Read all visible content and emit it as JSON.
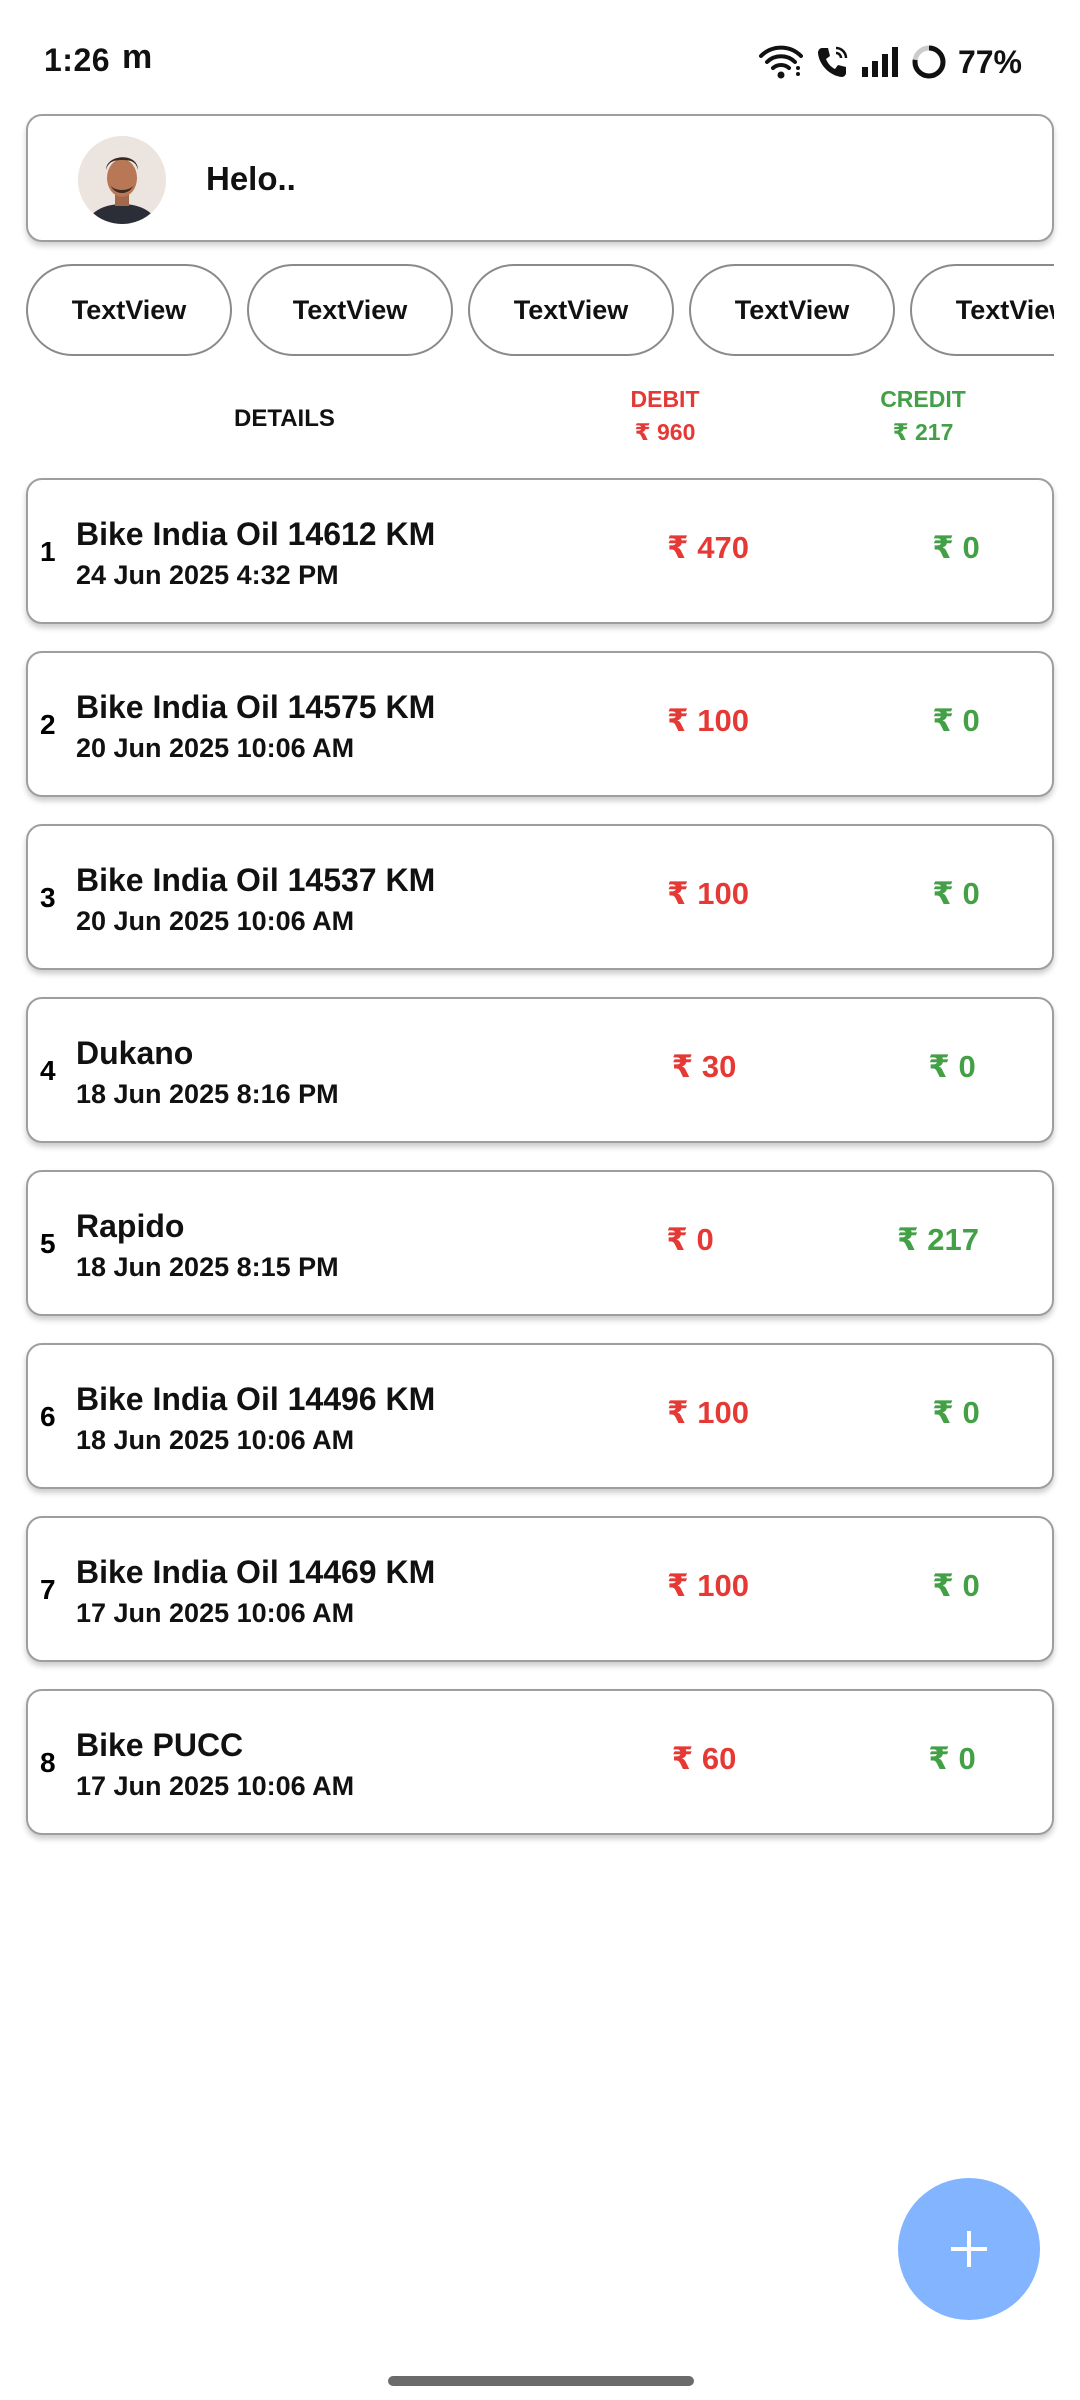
{
  "status_bar": {
    "time": "1:26",
    "app_indicator": "m",
    "battery": "77%",
    "icons": [
      "wifi-icon",
      "wifi-calling-icon",
      "signal-icon",
      "battery-ring-icon"
    ]
  },
  "header": {
    "greeting": "Helo..",
    "avatar": "profile-photo"
  },
  "chips": [
    "TextView",
    "TextView",
    "TextView",
    "TextView",
    "TextView"
  ],
  "columns": {
    "details": "DETAILS",
    "debit_label": "DEBIT",
    "debit_total": "₹ 960",
    "credit_label": "CREDIT",
    "credit_total": "₹ 217"
  },
  "colors": {
    "debit": "#e53935",
    "credit": "#43a047",
    "fab": "#82b4ff"
  },
  "entries": [
    {
      "index": "1",
      "title": "Bike India Oil 14612 KM",
      "date": "24 Jun 2025 4:32 PM",
      "debit": "₹ 470",
      "credit": "₹ 0"
    },
    {
      "index": "2",
      "title": "Bike India Oil 14575 KM",
      "date": "20 Jun 2025 10:06 AM",
      "debit": "₹ 100",
      "credit": "₹ 0"
    },
    {
      "index": "3",
      "title": "Bike India Oil 14537 KM",
      "date": "20 Jun 2025 10:06 AM",
      "debit": "₹ 100",
      "credit": "₹ 0"
    },
    {
      "index": "4",
      "title": "Dukano",
      "date": "18 Jun 2025 8:16 PM",
      "debit": "₹ 30",
      "credit": "₹ 0"
    },
    {
      "index": "5",
      "title": "Rapido",
      "date": "18 Jun 2025 8:15 PM",
      "debit": "₹ 0",
      "credit": "₹ 217"
    },
    {
      "index": "6",
      "title": "Bike India Oil 14496 KM",
      "date": "18 Jun 2025 10:06 AM",
      "debit": "₹ 100",
      "credit": "₹ 0"
    },
    {
      "index": "7",
      "title": "Bike India Oil 14469 KM",
      "date": "17 Jun 2025 10:06 AM",
      "debit": "₹ 100",
      "credit": "₹ 0"
    },
    {
      "index": "8",
      "title": "Bike PUCC",
      "date": "17 Jun 2025 10:06 AM",
      "debit": "₹ 60",
      "credit": "₹ 0"
    }
  ],
  "fab": {
    "icon": "plus-icon"
  }
}
